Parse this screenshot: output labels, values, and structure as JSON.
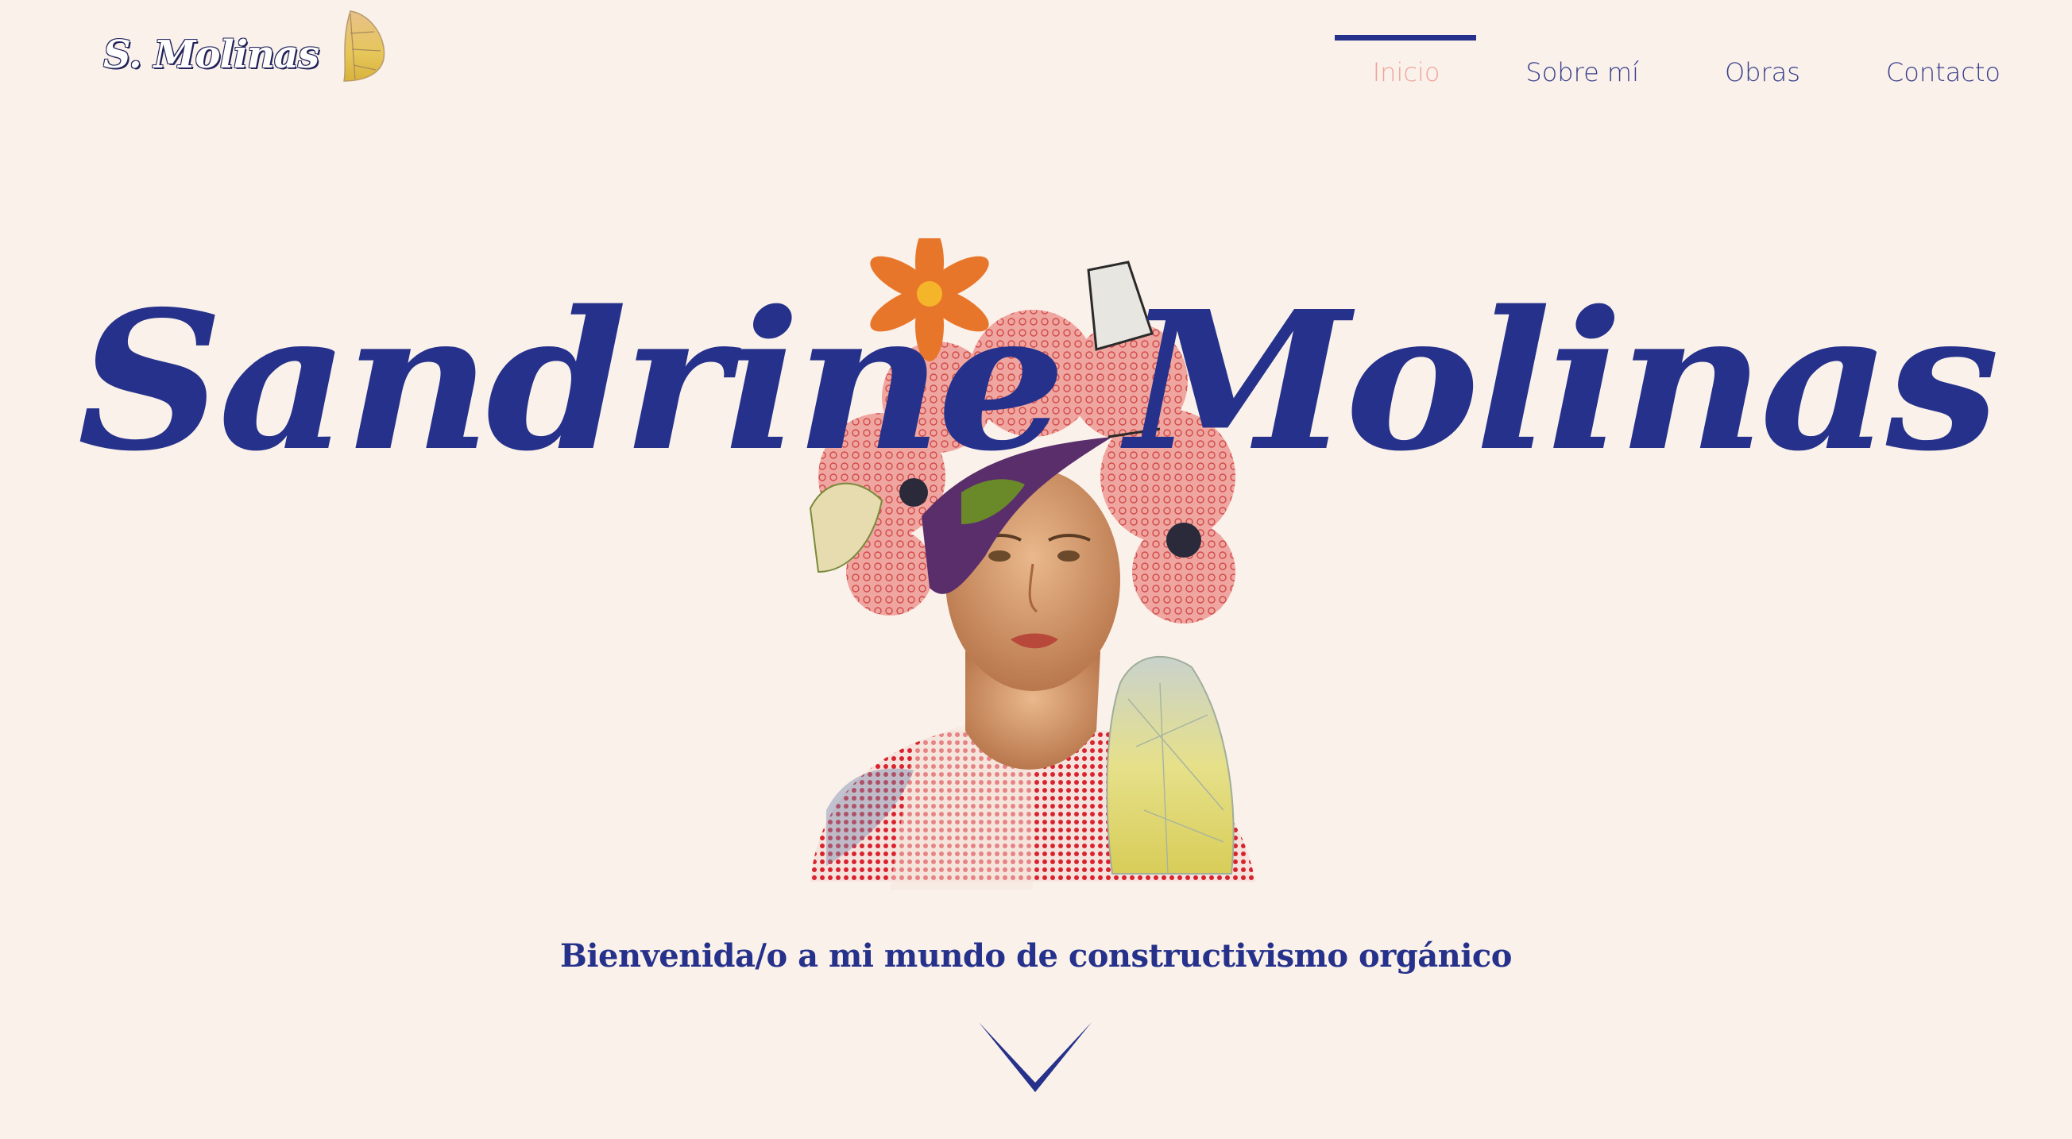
{
  "logo": {
    "text": "S. Molinas",
    "icon": "butterfly-wing-icon"
  },
  "nav": {
    "items": [
      {
        "label": "Inicio",
        "active": true
      },
      {
        "label": "Sobre mí",
        "active": false
      },
      {
        "label": "Obras",
        "active": false
      },
      {
        "label": "Contacto",
        "active": false
      }
    ]
  },
  "hero": {
    "title": "Sandrine Molinas",
    "tagline": "Bienvenida/o a mi mundo de constructivismo orgánico",
    "portrait_icon": "collage-portrait-artwork",
    "scroll_icon": "chevron-down-icon"
  },
  "colors": {
    "background": "#faf1ea",
    "brand_blue": "#25318b",
    "nav_text": "#3a3f8d",
    "nav_active": "#efa49a"
  }
}
